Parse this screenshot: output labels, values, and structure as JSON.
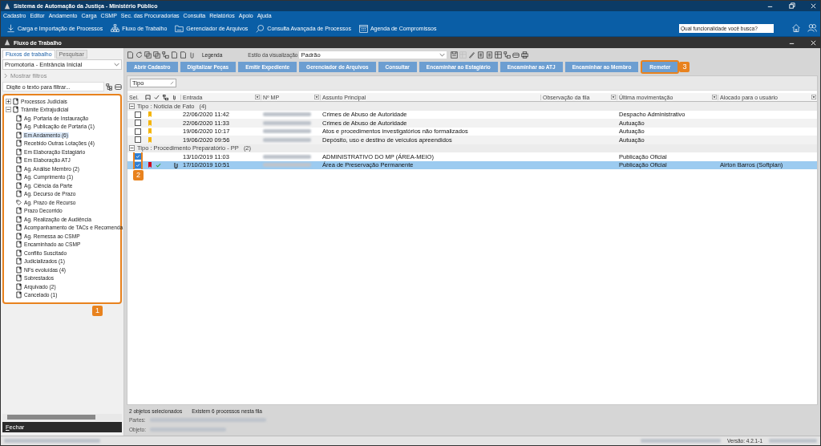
{
  "window": {
    "title": "Sistema de Automação da Justiça - Ministério Público"
  },
  "menu": [
    "Cadastro",
    "Editor",
    "Andamento",
    "Carga",
    "CSMP",
    "Sec. das Procuradorias",
    "Consulta",
    "Relatórios",
    "Apoio",
    "Ajuda"
  ],
  "quick_links": [
    {
      "label": "Carga e Importação de Processos",
      "kind": "download"
    },
    {
      "label": "Fluxo de Trabalho",
      "kind": "hierarchy"
    },
    {
      "label": "Gerenciador de Arquivos",
      "kind": "folder"
    },
    {
      "label": "Consulta Avançada de Processos",
      "kind": "search"
    },
    {
      "label": "Agenda de Compromissos",
      "kind": "calendar"
    }
  ],
  "search": {
    "placeholder": "Qual funcionalidade você busca?"
  },
  "panel": {
    "title": "Fluxo de Trabalho"
  },
  "left": {
    "tabs": [
      {
        "label": "Fluxos de trabalho",
        "selected": true
      },
      {
        "label": "Pesquisar",
        "selected": false
      }
    ],
    "dropdown": "Promotoria - Entrância Inicial",
    "show_filters": "Mostrar filtros",
    "filter": {
      "placeholder": "Digite o texto para filtrar..."
    },
    "annotation": "1",
    "tree": [
      {
        "label": "Processos Judiciais",
        "expanded": false
      },
      {
        "label": "Trâmite Extrajudicial",
        "expanded": true,
        "children": [
          {
            "label": "Ag. Portaria de Instauração",
            "selected": false,
            "kind": "doc"
          },
          {
            "label": "Ag. Publicação de Portaria (1)",
            "selected": false,
            "kind": "doc"
          },
          {
            "label": "Em Andamento (6)",
            "selected": true,
            "kind": "doc"
          },
          {
            "label": "Recebido Outras Lotações (4)",
            "selected": false,
            "kind": "doc"
          },
          {
            "label": "Em Elaboração Estagiário",
            "selected": false,
            "kind": "doc"
          },
          {
            "label": "Em Elaboração ATJ",
            "selected": false,
            "kind": "doc"
          },
          {
            "label": "Ag. Análise Membro (2)",
            "selected": false,
            "kind": "doc"
          },
          {
            "label": "Ag. Cumprimento (1)",
            "selected": false,
            "kind": "doc"
          },
          {
            "label": "Ag. Ciência da Parte",
            "selected": false,
            "kind": "doc"
          },
          {
            "label": "Ag. Decurso de Prazo",
            "selected": false,
            "kind": "doc"
          },
          {
            "label": "Ag. Prazo de Recurso",
            "selected": false,
            "kind": "tag"
          },
          {
            "label": "Prazo Decorrido",
            "selected": false,
            "kind": "doc"
          },
          {
            "label": "Ag. Realização de Audiência",
            "selected": false,
            "kind": "doc"
          },
          {
            "label": "Acompanhamento de TACs e Recomenda",
            "selected": false,
            "kind": "doc"
          },
          {
            "label": "Ag. Remessa ao CSMP",
            "selected": false,
            "kind": "doc"
          },
          {
            "label": "Encaminhado ao CSMP",
            "selected": false,
            "kind": "doc"
          },
          {
            "label": "Conflito Suscitado",
            "selected": false,
            "kind": "doc"
          },
          {
            "label": "Judicializados (1)",
            "selected": false,
            "kind": "doc"
          },
          {
            "label": "NFs evoluídas (4)",
            "selected": false,
            "kind": "doc"
          },
          {
            "label": "Sobrestados",
            "selected": false,
            "kind": "doc"
          },
          {
            "label": "Arquivado (2)",
            "selected": false,
            "kind": "doc"
          },
          {
            "label": "Cancelado (1)",
            "selected": false,
            "kind": "doc"
          }
        ]
      }
    ],
    "close_button": "Fechar"
  },
  "toolbar": {
    "legend": "Legenda",
    "view_style_label": "Estilo da visualização",
    "view_style": "Padrão"
  },
  "actions": [
    {
      "label": "Abrir Cadastro"
    },
    {
      "label": "Digitalizar Peças"
    },
    {
      "label": "Emitir Expediente"
    },
    {
      "label": "Gerenciador de Arquivos"
    },
    {
      "label": "Consultar"
    },
    {
      "label": "Encaminhar ao Estagiário"
    },
    {
      "label": "Encaminhar ao ATJ"
    },
    {
      "label": "Encaminhar ao Membro"
    },
    {
      "label": "Remeter",
      "annotation": "3"
    }
  ],
  "group_by": "Tipo",
  "table": {
    "columns": [
      "Sel.",
      "Entrada",
      "Nº MP",
      "Assunto Principal",
      "Observação da fila",
      "Última movimentação",
      "Alocado para o usuário"
    ],
    "groups": [
      {
        "label": "Tipo : Notícia de Fato",
        "count": "(4)",
        "expanded": true,
        "rows": [
          {
            "checked": false,
            "color": "#f5b400",
            "validated": false,
            "attachment": false,
            "selected": false,
            "entrada": "22/06/2020 11:42",
            "assunto": "Crimes de Abuso de Autoridade",
            "ultima": "Despacho Administrativo"
          },
          {
            "checked": false,
            "color": "#f5b400",
            "validated": false,
            "attachment": false,
            "selected": false,
            "entrada": "22/06/2020 11:33",
            "assunto": "Crimes de Abuso de Autoridade",
            "ultima": "Autuação"
          },
          {
            "checked": false,
            "color": "#f5b400",
            "validated": false,
            "attachment": false,
            "selected": false,
            "entrada": "19/06/2020 10:17",
            "assunto": "Atos e procedimentos investigatórios não formalizados",
            "ultima": "Autuação"
          },
          {
            "checked": false,
            "color": "#f5b400",
            "validated": false,
            "attachment": false,
            "selected": false,
            "entrada": "19/06/2020 09:56",
            "assunto": "Depósito, uso e destino de veículos apreendidos",
            "ultima": "Autuação"
          }
        ]
      },
      {
        "label": "Tipo : Procedimento Preparatório - PP",
        "count": "(2)",
        "expanded": true,
        "rows": [
          {
            "checked": true,
            "validated": false,
            "attachment": false,
            "selected": false,
            "entrada": "13/10/2019 11:03",
            "assunto": "ADMINISTRATIVO DO MP (ÁREA-MEIO)",
            "ultima": "Publicação Oficial"
          },
          {
            "checked": true,
            "color": "#d0021b",
            "validated": true,
            "attachment": true,
            "selected": true,
            "entrada": "17/10/2019 10:51",
            "assunto": "Área de Preservação Permanente",
            "ultima": "Publicação Oficial",
            "alocado": "Airton Barros (Softplan)",
            "annotation": "2"
          }
        ]
      }
    ]
  },
  "status": {
    "selection": "2 objetos selecionados",
    "count": "Existem 6 processos nesta fila",
    "parts_label": "Partes:",
    "object_label": "Objeto:"
  },
  "footer": {
    "version": "Versão: 4.2.1-1"
  }
}
